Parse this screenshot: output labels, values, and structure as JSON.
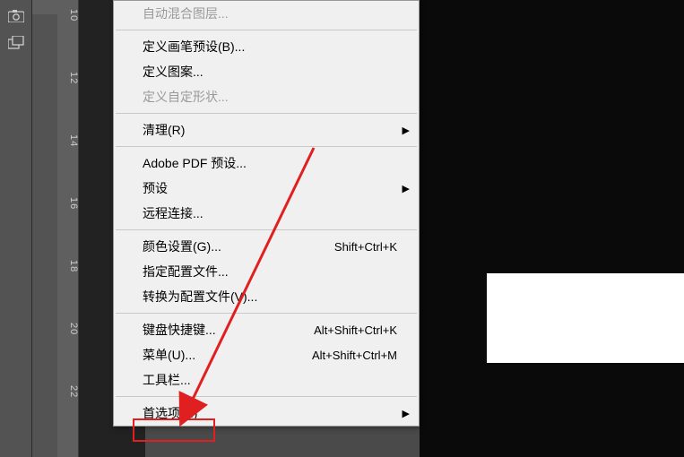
{
  "ruler": {
    "ticks": [
      "1 0",
      "1 2",
      "1 4",
      "1 6",
      "1 8",
      "2 0",
      "2 2"
    ]
  },
  "menu": {
    "auto_blend": "自动混合图层...",
    "define_brush": "定义画笔预设(B)...",
    "define_pattern": "定义图案...",
    "define_shape": "定义自定形状...",
    "purge": "清理(R)",
    "pdf_presets": "Adobe PDF 预设...",
    "presets": "预设",
    "remote_connect": "远程连接...",
    "color_settings": "颜色设置(G)...",
    "color_settings_sc": "Shift+Ctrl+K",
    "assign_profile": "指定配置文件...",
    "convert_profile": "转换为配置文件(V)...",
    "keyboard_sc_label": "键盘快捷键...",
    "keyboard_sc": "Alt+Shift+Ctrl+K",
    "menus_label": "菜单(U)...",
    "menus_sc": "Alt+Shift+Ctrl+M",
    "toolbar": "工具栏...",
    "preferences": "首选项(N)"
  }
}
